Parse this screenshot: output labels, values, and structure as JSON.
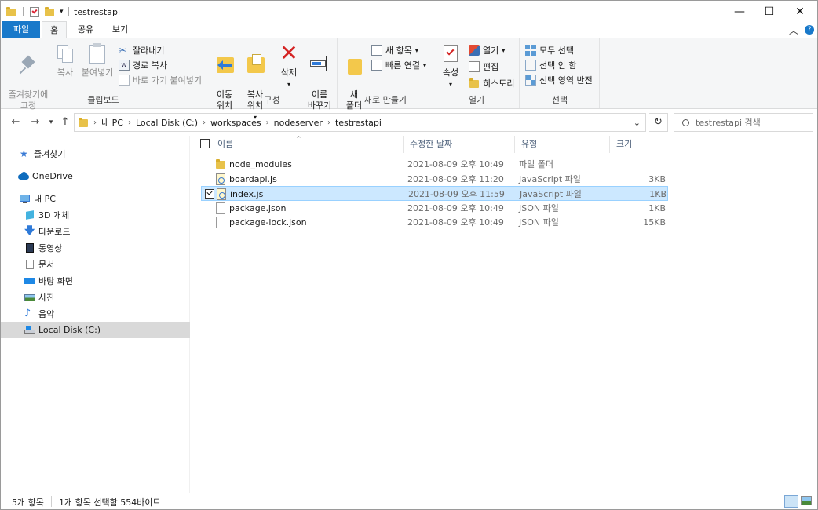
{
  "window": {
    "title": "testrestapi",
    "controls": {
      "minimize": "—",
      "maximize": "☐",
      "close": "✕"
    }
  },
  "ribbon_tabs": {
    "file": "파일",
    "home": "홈",
    "share": "공유",
    "view": "보기"
  },
  "ribbon": {
    "clipboard": {
      "label": "클립보드",
      "pin": "즐겨찾기에\n고정",
      "copy": "복사",
      "paste": "붙여넣기",
      "cut": "잘라내기",
      "copy_path": "경로 복사",
      "paste_shortcut": "바로 가기 붙여넣기"
    },
    "organize": {
      "label": "구성",
      "move_to": "이동\n위치",
      "copy_to": "복사\n위치",
      "delete": "삭제",
      "rename": "이름\n바꾸기"
    },
    "new": {
      "label": "새로 만들기",
      "new_folder": "새\n폴더",
      "new_item": "새 항목",
      "easy_access": "빠른 연결"
    },
    "open": {
      "label": "열기",
      "properties": "속성",
      "open": "열기",
      "edit": "편집",
      "history": "히스토리"
    },
    "select": {
      "label": "선택",
      "select_all": "모두 선택",
      "select_none": "선택 안 함",
      "invert": "선택 영역 반전"
    }
  },
  "address": {
    "crumbs": [
      "내 PC",
      "Local Disk (C:)",
      "workspaces",
      "nodeserver",
      "testrestapi"
    ],
    "search_placeholder": "testrestapi 검색"
  },
  "nav": {
    "items": [
      {
        "label": "즐겨찾기",
        "icon": "star-icon"
      },
      {
        "label": "OneDrive",
        "icon": "cloud-icon"
      },
      {
        "label": "내 PC",
        "icon": "computer-icon"
      },
      {
        "label": "3D 개체",
        "icon": "cube-icon"
      },
      {
        "label": "다운로드",
        "icon": "download-icon"
      },
      {
        "label": "동영상",
        "icon": "video-icon"
      },
      {
        "label": "문서",
        "icon": "document-icon"
      },
      {
        "label": "바탕 화면",
        "icon": "desktop-icon"
      },
      {
        "label": "사진",
        "icon": "picture-icon"
      },
      {
        "label": "음악",
        "icon": "music-icon"
      },
      {
        "label": "Local Disk (C:)",
        "icon": "drive-icon"
      }
    ]
  },
  "columns": {
    "name": "이름",
    "date": "수정한 날짜",
    "type": "유형",
    "size": "크기"
  },
  "files": [
    {
      "name": "node_modules",
      "date": "2021-08-09 오후 10:49",
      "type": "파일 폴더",
      "size": "",
      "icon": "folder-icon"
    },
    {
      "name": "boardapi.js",
      "date": "2021-08-09 오후 11:20",
      "type": "JavaScript 파일",
      "size": "3KB",
      "icon": "js-file-icon"
    },
    {
      "name": "index.js",
      "date": "2021-08-09 오후 11:59",
      "type": "JavaScript 파일",
      "size": "1KB",
      "icon": "js-file-icon"
    },
    {
      "name": "package.json",
      "date": "2021-08-09 오후 10:49",
      "type": "JSON 파일",
      "size": "1KB",
      "icon": "file-icon"
    },
    {
      "name": "package-lock.json",
      "date": "2021-08-09 오후 10:49",
      "type": "JSON 파일",
      "size": "15KB",
      "icon": "file-icon"
    }
  ],
  "status": {
    "count": "5개 항목",
    "selection": "1개 항목 선택함 554바이트"
  },
  "colors": {
    "file_tab": "#1979ca",
    "selection_bg": "#cce8ff",
    "selection_border": "#99d1ff",
    "nav_selected": "#d9d9d9"
  }
}
